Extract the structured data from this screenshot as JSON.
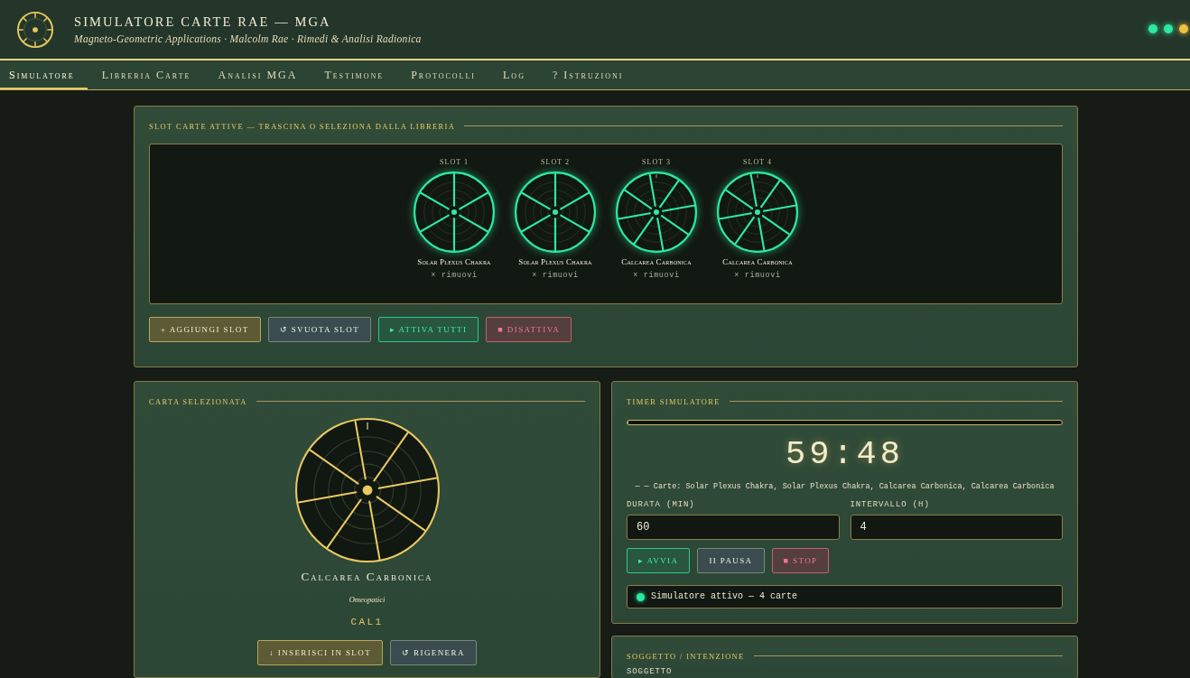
{
  "header": {
    "title": "SIMULATORE CARTE RAE — MGA",
    "subtitle": "Magneto-Geometric Applications · Malcolm Rae · Rimedi & Analisi Radionica",
    "indicators": [
      {
        "color": "#2ee8a0"
      },
      {
        "color": "#2ee8a0"
      },
      {
        "color": "#f0c040"
      }
    ]
  },
  "nav": [
    {
      "label": "Simulatore",
      "selected": true
    },
    {
      "label": "Libreria Carte",
      "selected": false
    },
    {
      "label": "Analisi MGA",
      "selected": false
    },
    {
      "label": "Testimone",
      "selected": false
    },
    {
      "label": "Protocolli",
      "selected": false
    },
    {
      "label": "Log",
      "selected": false
    },
    {
      "label": "? Istruzioni",
      "selected": false
    }
  ],
  "slots_panel": {
    "title": "SLOT CARTE ATTIVE — TRASCINA O SELEZIONA DALLA LIBRERIA",
    "slots": [
      {
        "label": "SLOT 1",
        "card": "Solar Plexus Chakra",
        "kind": "sixfold",
        "active": true,
        "remove": "× rimuovi"
      },
      {
        "label": "SLOT 2",
        "card": "Solar Plexus Chakra",
        "kind": "sixfold",
        "active": true,
        "remove": "× rimuovi"
      },
      {
        "label": "SLOT 3",
        "card": "Calcarea Carbonica",
        "kind": "eightfold",
        "active": true,
        "remove": "× rimuovi"
      },
      {
        "label": "SLOT 4",
        "card": "Calcarea Carbonica",
        "kind": "eightfold",
        "active": true,
        "remove": "× rimuovi"
      }
    ],
    "buttons": [
      {
        "label": "+ AGGIUNGI SLOT",
        "kind": "add"
      },
      {
        "label": "↺ SVUOTA SLOT",
        "kind": "clear"
      },
      {
        "label": "▸ ATTIVA TUTTI",
        "kind": "start"
      },
      {
        "label": "■ DISATTIVA",
        "kind": "stop"
      }
    ]
  },
  "selected_card": {
    "title": "CARTA SELEZIONATA",
    "kind": "eightfold",
    "name": "Calcarea Carbonica",
    "category": "Omeopatici",
    "code": "CAL1",
    "buttons": [
      {
        "label": "↓ INSERISCI IN SLOT",
        "kind": "insert"
      },
      {
        "label": "↺ RIGENERA",
        "kind": "regenerate"
      }
    ]
  },
  "timer": {
    "title": "TIMER SIMULATORE",
    "progress": {
      "level": 0.003
    },
    "time": "59:48",
    "cards_line": "— — Carte: Solar Plexus Chakra, Solar Plexus Chakra, Calcarea Carbonica, Calcarea Carbonica",
    "fields": [
      {
        "label": "DURATA (MIN)",
        "value": "60"
      },
      {
        "label": "INTERVALLO (H)",
        "value": "4"
      }
    ],
    "buttons": [
      {
        "label": "▸ AVVIA",
        "kind": "start"
      },
      {
        "label": "II PAUSA",
        "kind": "pause"
      },
      {
        "label": "■ STOP",
        "kind": "stop"
      }
    ],
    "status": {
      "text": "Simulatore attivo — 4 carte",
      "running": true
    }
  },
  "subject": {
    "title": "SOGGETTO / INTENZIONE",
    "field_label": "SOGGETTO"
  }
}
